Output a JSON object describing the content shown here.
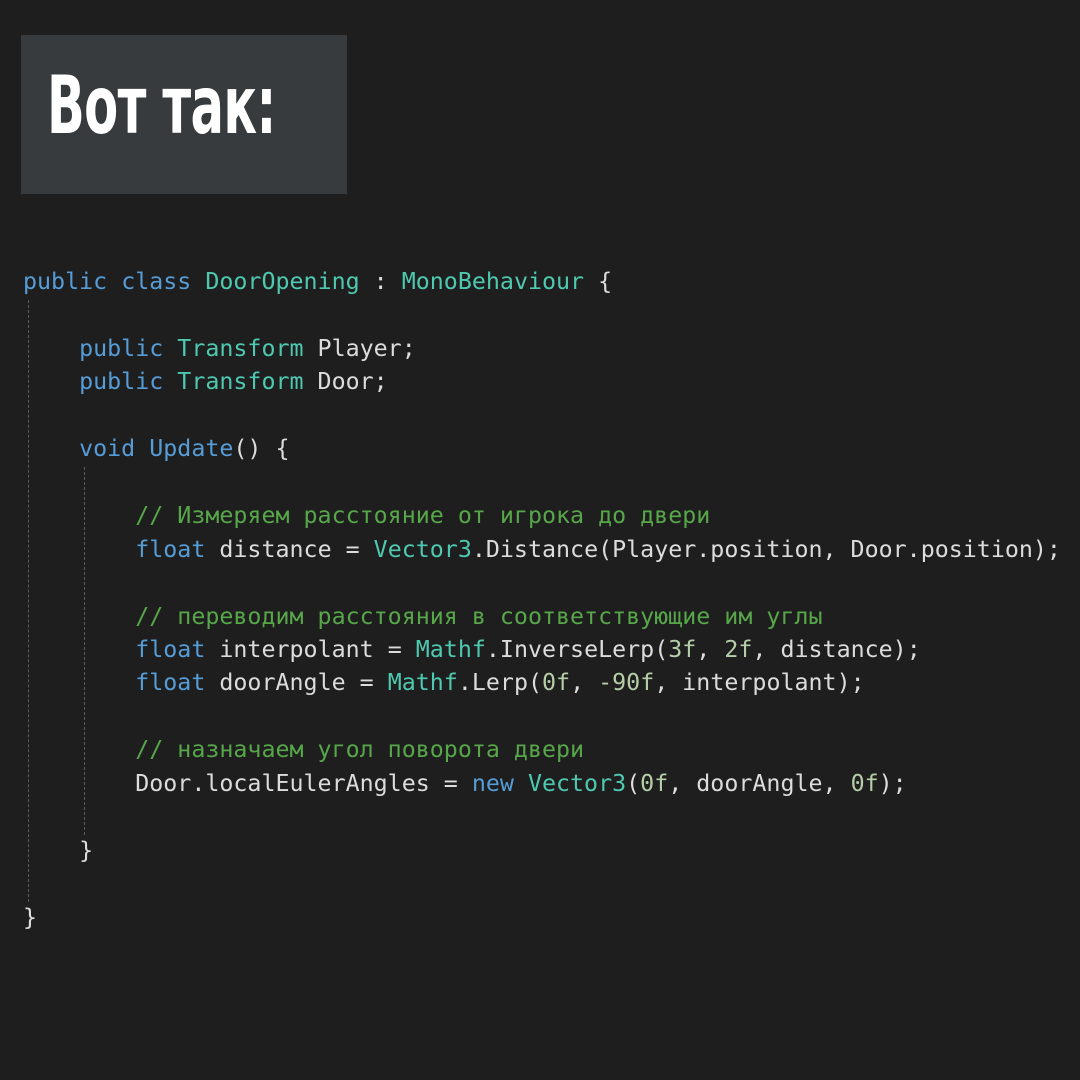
{
  "title": "Вот так:",
  "code": {
    "lines": [
      [
        {
          "t": "public",
          "c": "kw"
        },
        {
          "t": " ",
          "c": "tx"
        },
        {
          "t": "class",
          "c": "kw"
        },
        {
          "t": " ",
          "c": "tx"
        },
        {
          "t": "DoorOpening",
          "c": "ty"
        },
        {
          "t": " : ",
          "c": "tx"
        },
        {
          "t": "MonoBehaviour",
          "c": "ty"
        },
        {
          "t": " {",
          "c": "tx"
        }
      ],
      [],
      [
        {
          "t": "    ",
          "c": "tx"
        },
        {
          "t": "public",
          "c": "kw"
        },
        {
          "t": " ",
          "c": "tx"
        },
        {
          "t": "Transform",
          "c": "ty"
        },
        {
          "t": " Player;",
          "c": "tx"
        }
      ],
      [
        {
          "t": "    ",
          "c": "tx"
        },
        {
          "t": "public",
          "c": "kw"
        },
        {
          "t": " ",
          "c": "tx"
        },
        {
          "t": "Transform",
          "c": "ty"
        },
        {
          "t": " Door;",
          "c": "tx"
        }
      ],
      [],
      [
        {
          "t": "    ",
          "c": "tx"
        },
        {
          "t": "void",
          "c": "kw"
        },
        {
          "t": " ",
          "c": "tx"
        },
        {
          "t": "Update",
          "c": "kw"
        },
        {
          "t": "() {",
          "c": "tx"
        }
      ],
      [],
      [
        {
          "t": "        ",
          "c": "tx"
        },
        {
          "t": "// Измеряем расстояние от игрока до двери",
          "c": "cm"
        }
      ],
      [
        {
          "t": "        ",
          "c": "tx"
        },
        {
          "t": "float",
          "c": "kw"
        },
        {
          "t": " distance = ",
          "c": "tx"
        },
        {
          "t": "Vector3",
          "c": "ty"
        },
        {
          "t": ".Distance(Player.position, Door.position);",
          "c": "tx"
        }
      ],
      [],
      [
        {
          "t": "        ",
          "c": "tx"
        },
        {
          "t": "// переводим расстояния в соответствующие им углы",
          "c": "cm"
        }
      ],
      [
        {
          "t": "        ",
          "c": "tx"
        },
        {
          "t": "float",
          "c": "kw"
        },
        {
          "t": " interpolant = ",
          "c": "tx"
        },
        {
          "t": "Mathf",
          "c": "ty"
        },
        {
          "t": ".InverseLerp(",
          "c": "tx"
        },
        {
          "t": "3f",
          "c": "nm"
        },
        {
          "t": ", ",
          "c": "tx"
        },
        {
          "t": "2f",
          "c": "nm"
        },
        {
          "t": ", distance);",
          "c": "tx"
        }
      ],
      [
        {
          "t": "        ",
          "c": "tx"
        },
        {
          "t": "float",
          "c": "kw"
        },
        {
          "t": " doorAngle = ",
          "c": "tx"
        },
        {
          "t": "Mathf",
          "c": "ty"
        },
        {
          "t": ".Lerp(",
          "c": "tx"
        },
        {
          "t": "0f",
          "c": "nm"
        },
        {
          "t": ", ",
          "c": "tx"
        },
        {
          "t": "-90f",
          "c": "nm"
        },
        {
          "t": ", interpolant);",
          "c": "tx"
        }
      ],
      [],
      [
        {
          "t": "        ",
          "c": "tx"
        },
        {
          "t": "// назначаем угол поворота двери",
          "c": "cm"
        }
      ],
      [
        {
          "t": "        ",
          "c": "tx"
        },
        {
          "t": "Door.localEulerAngles = ",
          "c": "tx"
        },
        {
          "t": "new",
          "c": "kw"
        },
        {
          "t": " ",
          "c": "tx"
        },
        {
          "t": "Vector3",
          "c": "ty"
        },
        {
          "t": "(",
          "c": "tx"
        },
        {
          "t": "0f",
          "c": "nm"
        },
        {
          "t": ", doorAngle, ",
          "c": "tx"
        },
        {
          "t": "0f",
          "c": "nm"
        },
        {
          "t": ");",
          "c": "tx"
        }
      ],
      [],
      [
        {
          "t": "    }",
          "c": "tx"
        }
      ],
      [],
      [
        {
          "t": "}",
          "c": "tx"
        }
      ]
    ]
  }
}
